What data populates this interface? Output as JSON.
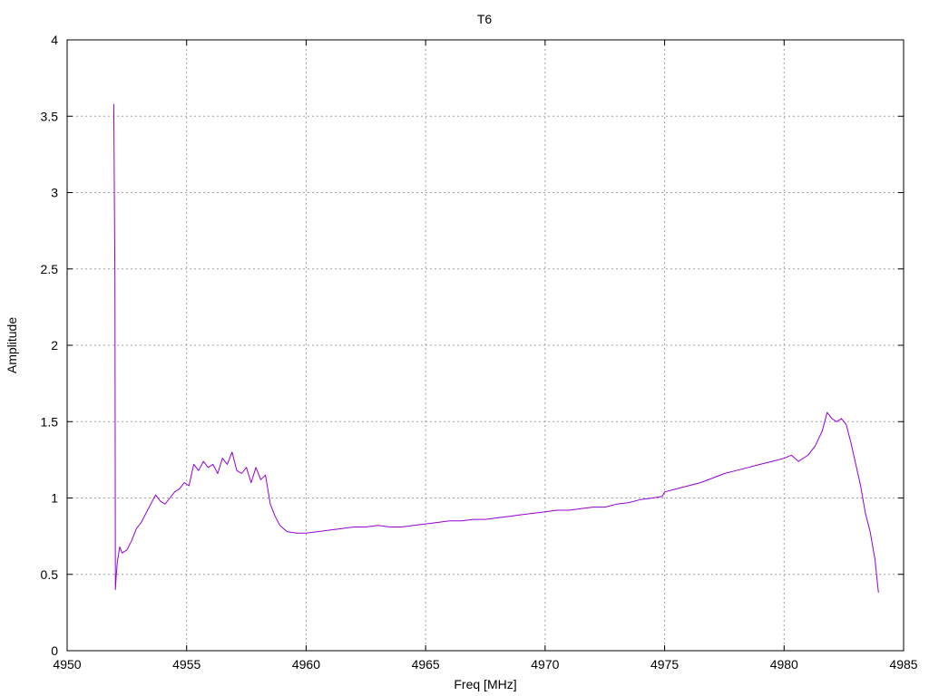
{
  "chart_data": {
    "type": "line",
    "title": "T6",
    "xlabel": "Freq [MHz]",
    "ylabel": "Amplitude",
    "xlim": [
      4950,
      4985
    ],
    "ylim": [
      0,
      4
    ],
    "xticks": [
      "4950",
      "4955",
      "4960",
      "4965",
      "4970",
      "4975",
      "4980",
      "4985"
    ],
    "yticks": [
      "0",
      "0.5",
      "1",
      "1.5",
      "2",
      "2.5",
      "3",
      "3.5",
      "4"
    ],
    "grid": true,
    "legend": "none",
    "series": [
      {
        "color": "#9400d3",
        "x": [
          4951.95,
          4952.0,
          4952.02,
          4952.05,
          4952.1,
          4952.2,
          4952.3,
          4952.5,
          4952.7,
          4952.9,
          4953.1,
          4953.3,
          4953.5,
          4953.7,
          4953.9,
          4954.1,
          4954.3,
          4954.5,
          4954.7,
          4954.9,
          4955.1,
          4955.3,
          4955.5,
          4955.7,
          4955.9,
          4956.1,
          4956.3,
          4956.5,
          4956.7,
          4956.9,
          4957.1,
          4957.3,
          4957.5,
          4957.7,
          4957.9,
          4958.1,
          4958.3,
          4958.5,
          4958.7,
          4958.9,
          4959.2,
          4959.6,
          4960.0,
          4960.5,
          4961.0,
          4961.5,
          4962.0,
          4962.5,
          4963.0,
          4963.5,
          4964.0,
          4964.5,
          4965.0,
          4965.5,
          4966.0,
          4966.5,
          4967.0,
          4967.5,
          4968.0,
          4968.5,
          4969.0,
          4969.5,
          4970.0,
          4970.5,
          4971.0,
          4971.5,
          4972.0,
          4972.5,
          4973.0,
          4973.5,
          4974.0,
          4974.5,
          4974.9,
          4975.0,
          4975.5,
          4976.0,
          4976.5,
          4977.0,
          4977.5,
          4978.0,
          4978.5,
          4979.0,
          4979.5,
          4980.0,
          4980.3,
          4980.6,
          4981.0,
          4981.3,
          4981.6,
          4981.8,
          4982.0,
          4982.2,
          4982.4,
          4982.6,
          4982.8,
          4983.0,
          4983.2,
          4983.4,
          4983.6,
          4983.8,
          4983.95
        ],
        "y": [
          3.58,
          2.42,
          0.4,
          0.48,
          0.58,
          0.68,
          0.64,
          0.66,
          0.72,
          0.8,
          0.84,
          0.9,
          0.96,
          1.02,
          0.98,
          0.96,
          1.0,
          1.04,
          1.06,
          1.1,
          1.08,
          1.22,
          1.18,
          1.24,
          1.2,
          1.22,
          1.16,
          1.26,
          1.22,
          1.3,
          1.18,
          1.16,
          1.2,
          1.1,
          1.2,
          1.12,
          1.15,
          0.96,
          0.88,
          0.82,
          0.78,
          0.77,
          0.77,
          0.78,
          0.79,
          0.8,
          0.81,
          0.81,
          0.82,
          0.81,
          0.81,
          0.82,
          0.83,
          0.84,
          0.85,
          0.85,
          0.86,
          0.86,
          0.87,
          0.88,
          0.89,
          0.9,
          0.91,
          0.92,
          0.92,
          0.93,
          0.94,
          0.94,
          0.96,
          0.97,
          0.99,
          1.0,
          1.01,
          1.04,
          1.06,
          1.08,
          1.1,
          1.13,
          1.16,
          1.18,
          1.2,
          1.22,
          1.24,
          1.26,
          1.28,
          1.24,
          1.28,
          1.34,
          1.44,
          1.56,
          1.52,
          1.5,
          1.52,
          1.48,
          1.36,
          1.22,
          1.08,
          0.9,
          0.78,
          0.6,
          0.38
        ]
      }
    ]
  }
}
